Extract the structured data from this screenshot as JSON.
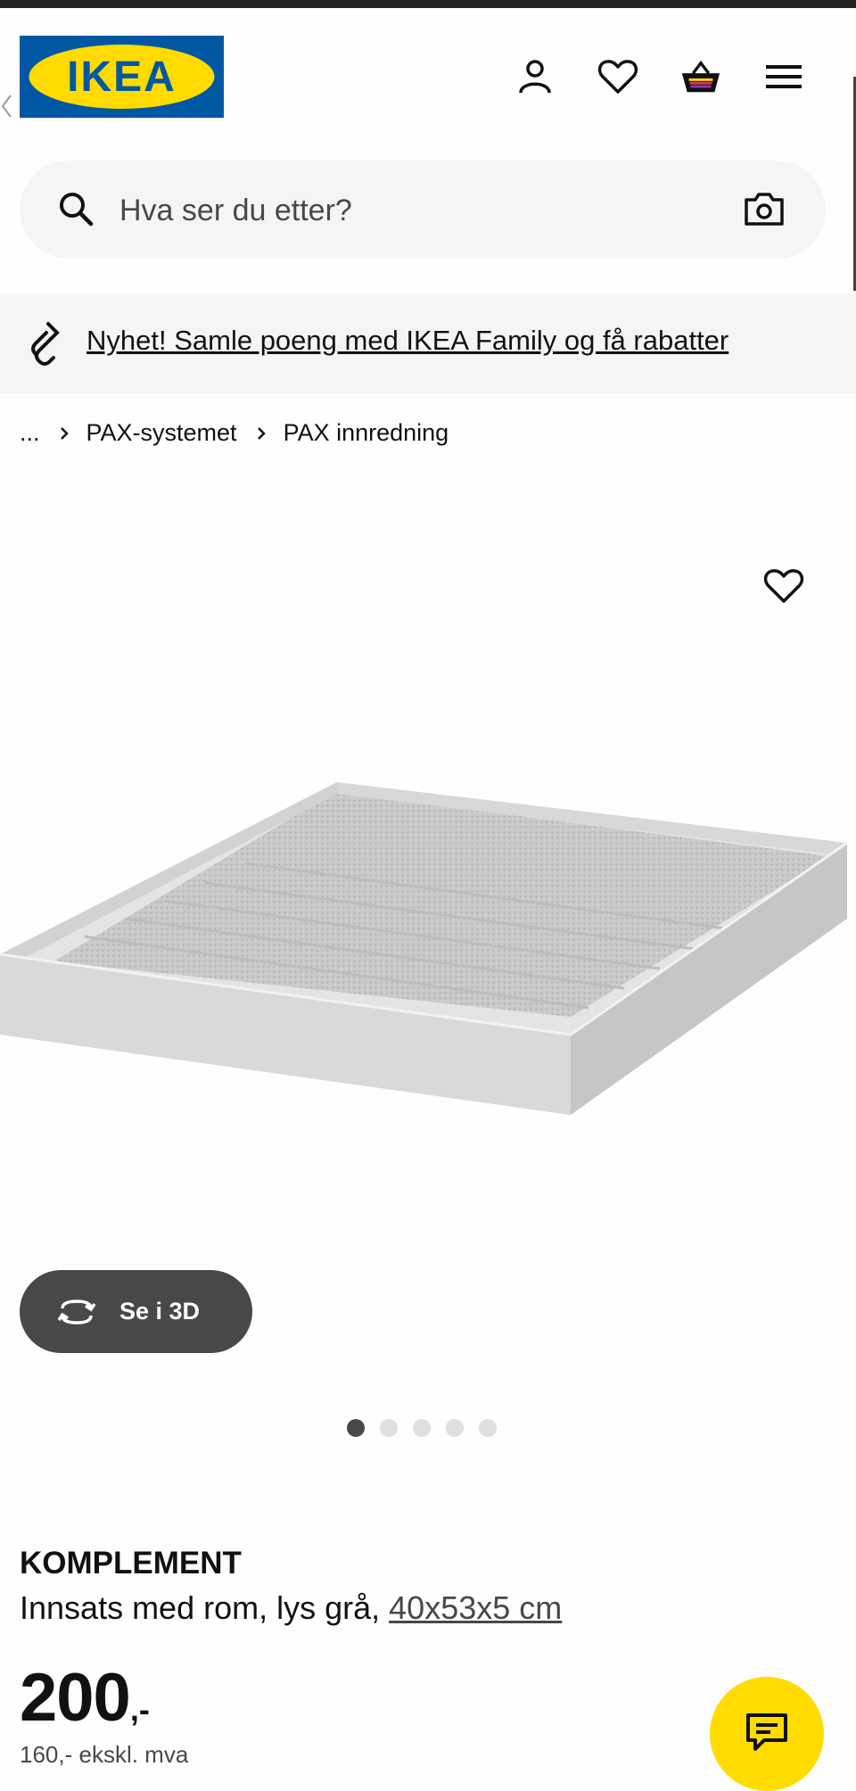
{
  "header": {
    "logo_text": "IKEA",
    "brand_colors": {
      "blue": "#0058a3",
      "yellow": "#ffdb00"
    },
    "icons": [
      "profile-icon",
      "heart-icon",
      "cart-icon",
      "menu-icon"
    ]
  },
  "search": {
    "placeholder": "Hva ser du etter?",
    "icons": [
      "search-icon",
      "camera-icon"
    ]
  },
  "promo": {
    "text": "Nyhet! Samle poeng med IKEA Family og få rabatter",
    "icon": "ikea-family-icon"
  },
  "breadcrumb": {
    "ellipsis": "...",
    "items": [
      "PAX-systemet",
      "PAX innredning"
    ]
  },
  "gallery": {
    "view_3d_label": "Se i 3D",
    "image_count": 5,
    "active_index": 0
  },
  "product": {
    "name": "KOMPLEMENT",
    "description": "Innsats med rom, lys grå,",
    "dimensions": "40x53x5 cm",
    "price": "200",
    "currency_suffix": ",-",
    "vat_text": "160,- ekskl. mva"
  }
}
